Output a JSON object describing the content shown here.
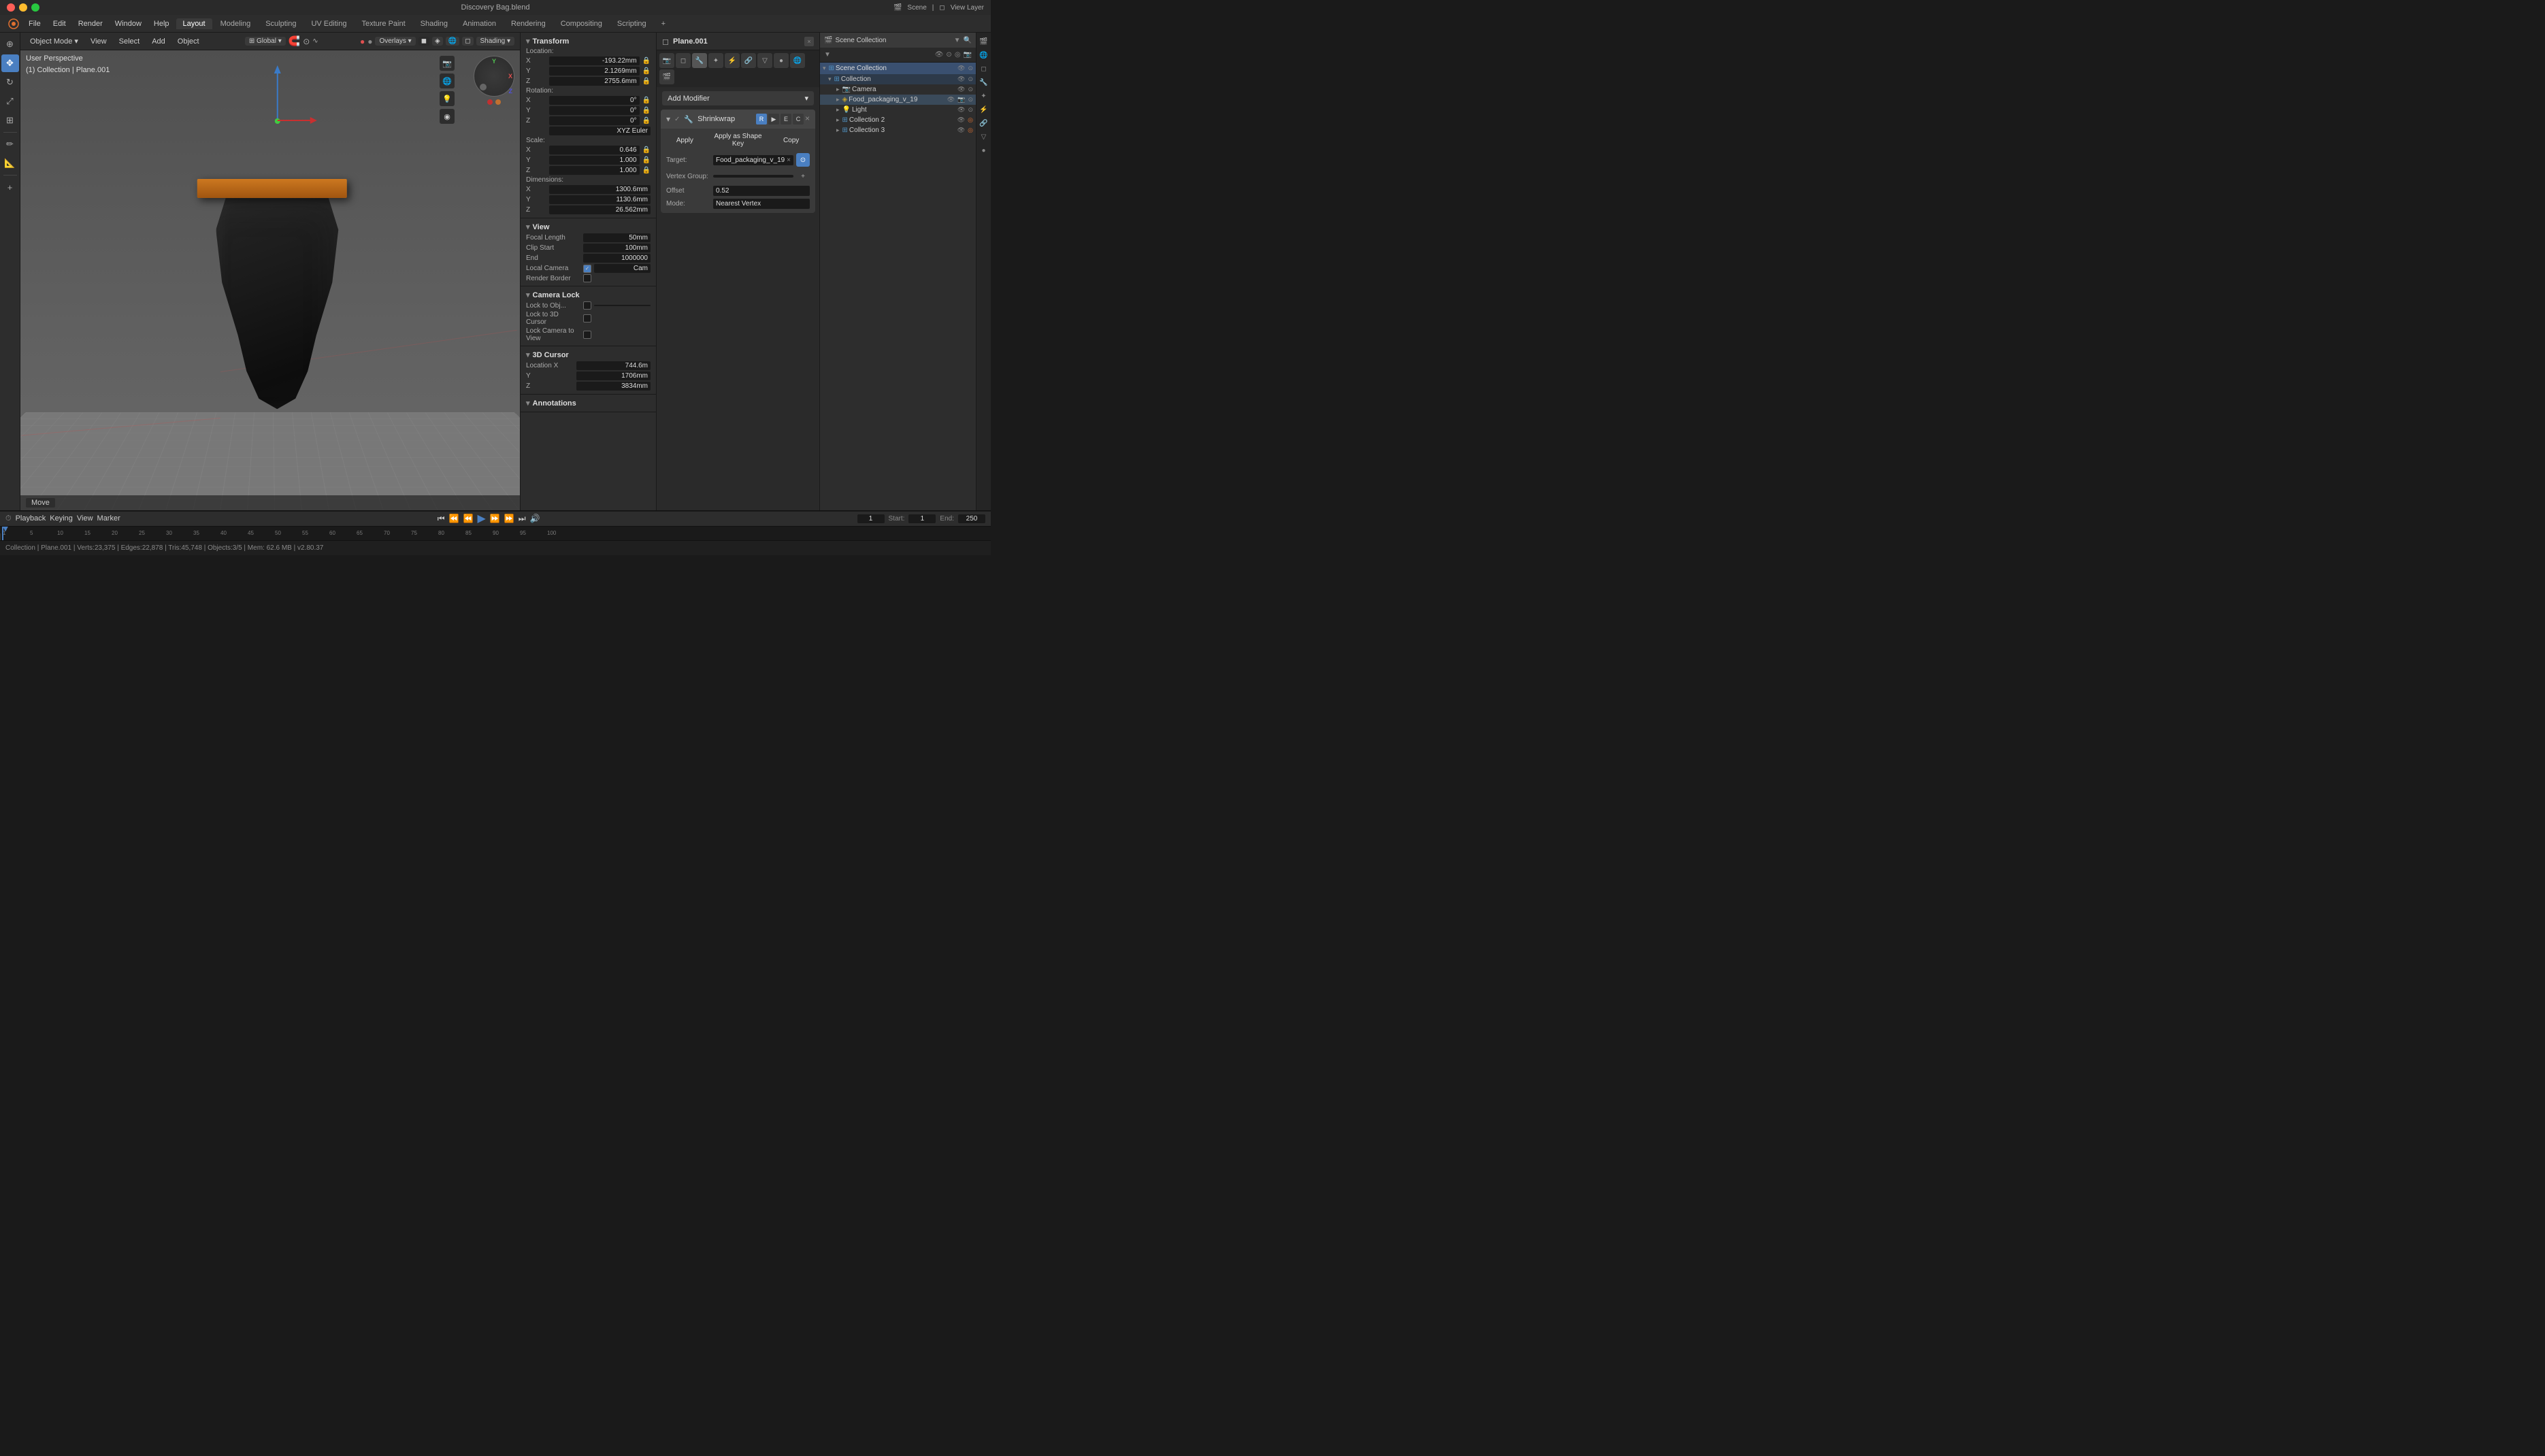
{
  "window": {
    "title": "Discovery Bag.blend",
    "traffic_lights": [
      "close",
      "minimize",
      "maximize"
    ]
  },
  "menu": {
    "left_icon": "blender-logo",
    "items": [
      "File",
      "Edit",
      "Render",
      "Window",
      "Help"
    ],
    "workspaces": [
      "Layout",
      "Modeling",
      "Sculpting",
      "UV Editing",
      "Texture Paint",
      "Shading",
      "Animation",
      "Rendering",
      "Compositing",
      "Scripting"
    ],
    "active_workspace": "Layout",
    "scene": "Scene",
    "view_layer": "View Layer",
    "plus_tab": "+"
  },
  "viewport": {
    "mode": "Object Mode",
    "menus": [
      "Object Mode",
      "View",
      "Select",
      "Add",
      "Object"
    ],
    "transform_orientation": "Global",
    "info_text": [
      "User Perspective",
      "(1) Collection | Plane.001"
    ],
    "overlays_btn": "Overlays",
    "shading_btn": "Shading",
    "gizmo": {
      "x_label": "X",
      "y_label": "Y",
      "z_label": "Z"
    },
    "bottom_tag": "Move"
  },
  "properties_panel": {
    "title": "Transform",
    "location": {
      "label": "Location:",
      "x": {
        "label": "X",
        "value": "-193.22mm"
      },
      "y": {
        "label": "Y",
        "value": "2.1269mm"
      },
      "z": {
        "label": "Z",
        "value": "2755.6mm"
      }
    },
    "rotation": {
      "label": "Rotation:",
      "x": {
        "label": "X",
        "value": "0°"
      },
      "y": {
        "label": "Y",
        "value": "0°"
      },
      "z": {
        "label": "Z",
        "value": "0°"
      },
      "mode": "XYZ Euler"
    },
    "scale": {
      "label": "Scale:",
      "x": {
        "label": "X",
        "value": "0.646"
      },
      "y": {
        "label": "Y",
        "value": "1.000"
      },
      "z": {
        "label": "Z",
        "value": "1.000"
      }
    },
    "dimensions": {
      "label": "Dimensions:",
      "x": {
        "label": "X",
        "value": "1300.6mm"
      },
      "y": {
        "label": "Y",
        "value": "1130.6mm"
      },
      "z": {
        "label": "Z",
        "value": "26.562mm"
      }
    },
    "view_section": {
      "title": "View",
      "focal_length": {
        "label": "Focal Length",
        "value": "50mm"
      },
      "clip_start": {
        "label": "Clip Start",
        "value": "100mm"
      },
      "clip_end": {
        "label": "End",
        "value": "1000000"
      },
      "local_camera": {
        "label": "Local Camera",
        "value": "Cam"
      },
      "render_border": {
        "label": "Render Border"
      }
    },
    "camera_lock": {
      "title": "Camera Lock",
      "lock_to_object": {
        "label": "Lock to Obj..."
      },
      "lock_to_3d_cursor": {
        "label": "Lock to 3D Cursor"
      },
      "lock_camera_to_view": {
        "label": "Lock Camera to View"
      }
    },
    "cursor_3d": {
      "title": "3D Cursor",
      "location_x": {
        "label": "Location X",
        "value": "744.6m"
      },
      "y": {
        "label": "Y",
        "value": "1706mm"
      },
      "z": {
        "label": "Z",
        "value": "3834mm"
      }
    },
    "annotations": {
      "title": "Annotations"
    }
  },
  "modifier_panel": {
    "object_name": "Plane.001",
    "add_modifier_label": "Add Modifier",
    "modifier_name": "Shrinkwrap",
    "buttons": {
      "apply": "Apply",
      "apply_as_shape_key": "Apply as Shape Key",
      "copy": "Copy"
    },
    "target": {
      "label": "Target:",
      "value": "Food_packaging_v_19"
    },
    "vertex_group": {
      "label": "Vertex Group:"
    },
    "offset": {
      "label": "Offset",
      "value": "0.52"
    },
    "mode": {
      "label": "Mode:",
      "value": "Nearest Vertex"
    }
  },
  "scene_collection": {
    "title": "Scene Collection",
    "items": [
      {
        "name": "Collection",
        "type": "collection",
        "indent": 0,
        "expanded": true
      },
      {
        "name": "Camera",
        "type": "camera",
        "indent": 1,
        "expanded": false
      },
      {
        "name": "Food_packaging_v_19",
        "type": "mesh",
        "indent": 1,
        "expanded": false
      },
      {
        "name": "Light",
        "type": "light",
        "indent": 1,
        "expanded": false
      },
      {
        "name": "Collection 2",
        "type": "collection",
        "indent": 1,
        "expanded": false
      },
      {
        "name": "Collection 3",
        "type": "collection",
        "indent": 1,
        "expanded": false
      }
    ]
  },
  "timeline": {
    "menus": [
      "Playback",
      "Keying",
      "View",
      "Marker"
    ],
    "current_frame": "1",
    "start_frame": "1",
    "end_frame": "250",
    "start_label": "Start:",
    "end_label": "End:"
  },
  "status_bar": {
    "text": "Collection | Plane.001 | Verts:23,375 | Edges:22,878 | Tris:45,748 | Objects:3/5 | Mem: 62.6 MB | v2.80.37"
  },
  "icons": {
    "arrow_cursor": "↖",
    "move": "✥",
    "rotate": "↻",
    "scale": "⤢",
    "transform": "⊞",
    "select_box": "⬚",
    "cursor": "⊕",
    "camera": "📷",
    "render": "▶",
    "light": "💡",
    "wrench": "🔧",
    "mesh": "◈",
    "eye": "👁",
    "scene": "🎬",
    "world": "🌐",
    "object": "◻",
    "material": "●",
    "particle": "✦",
    "physics": "⚡",
    "constraint": "🔗",
    "data": "▽",
    "modifier": "🔧",
    "chevron_down": "▾",
    "chevron_right": "▸",
    "play": "▶",
    "prev": "⏮",
    "next": "⏭",
    "jump_start": "⏭",
    "jump_end": "⏮",
    "skip_back": "⏪",
    "skip_fwd": "⏩",
    "pause": "⏸",
    "speaker": "🔊",
    "filter": "▼"
  }
}
